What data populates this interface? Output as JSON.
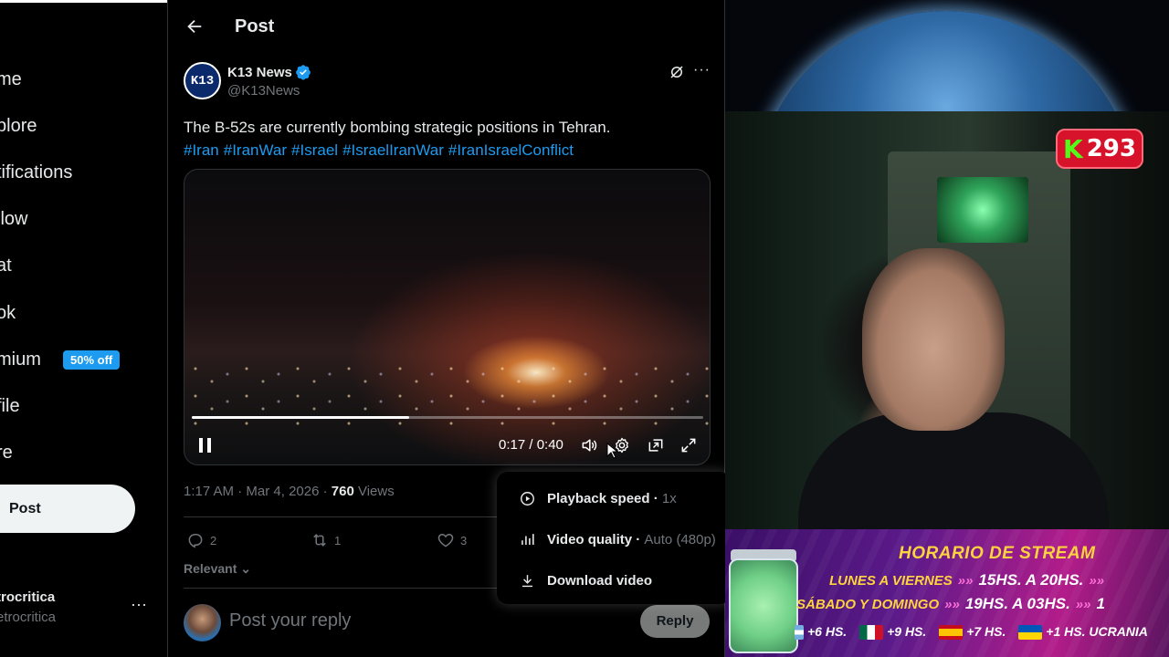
{
  "nav": {
    "items": [
      {
        "key": "home",
        "label": "me"
      },
      {
        "key": "explore",
        "label": "plore"
      },
      {
        "key": "notifications",
        "label": "tifications"
      },
      {
        "key": "follow",
        "label": "llow"
      },
      {
        "key": "chat",
        "label": "at"
      },
      {
        "key": "grok",
        "label": "ok"
      },
      {
        "key": "premium",
        "label": "mium"
      },
      {
        "key": "profile",
        "label": "file"
      },
      {
        "key": "more",
        "label": "re"
      }
    ],
    "premium_badge": "50% off",
    "post_button": "Post",
    "account": {
      "name": "trocritica",
      "handle": "etrocritica",
      "more": "···"
    }
  },
  "header": {
    "title": "Post"
  },
  "tweet": {
    "author_name": "K13 News",
    "author_handle": "@K13News",
    "avatar_text": "K13",
    "text": "The B-52s are currently bombing strategic positions in Tehran.",
    "hashtags": [
      "#Iran",
      "#IranWar",
      "#Israel",
      "#IsraelIranWar",
      "#IranIsraelConflict"
    ],
    "more": "···"
  },
  "video": {
    "time_readout": "0:17 / 0:40",
    "progress": 0.425
  },
  "meta": {
    "time": "1:17 AM",
    "date": "Mar 4, 2026",
    "views_count": "760",
    "views_label": "Views",
    "sep": "·"
  },
  "actions": {
    "replies": "2",
    "reposts": "1",
    "likes": "3"
  },
  "relevant": "Relevant",
  "reply": {
    "placeholder": "Post your reply",
    "button": "Reply"
  },
  "settings_menu": {
    "items": [
      {
        "label": "Playback speed",
        "value": "1x",
        "icon": "play-circle-icon"
      },
      {
        "label": "Video quality",
        "value": "Auto (480p)",
        "icon": "bar-chart-icon"
      },
      {
        "label": "Download video",
        "value": "",
        "icon": "download-icon"
      }
    ],
    "separator": "·"
  },
  "stream": {
    "viewer_count": "293",
    "kick_letter": "K",
    "schedule_title": "HORARIO DE STREAM",
    "rows": [
      {
        "days": "LUNES A VIERNES",
        "hours": "15HS. A 20HS."
      },
      {
        "days": "SÁBADO Y DOMINGO",
        "hours": "19HS. A 03HS."
      }
    ],
    "timezones": [
      {
        "flag": "ar",
        "offset": "+6 HS."
      },
      {
        "flag": "mx",
        "offset": "+9 HS."
      },
      {
        "flag": "es",
        "offset": "+7 HS."
      },
      {
        "flag": "ua",
        "offset": "+1 HS. UCRANIA"
      }
    ],
    "arrow": "»»",
    "trailing_char": "1"
  },
  "colors": {
    "accent": "#1d9bf0",
    "background": "#000000",
    "muted": "#71767b",
    "kick_green": "#53fc18",
    "kick_red": "#d6132a"
  }
}
